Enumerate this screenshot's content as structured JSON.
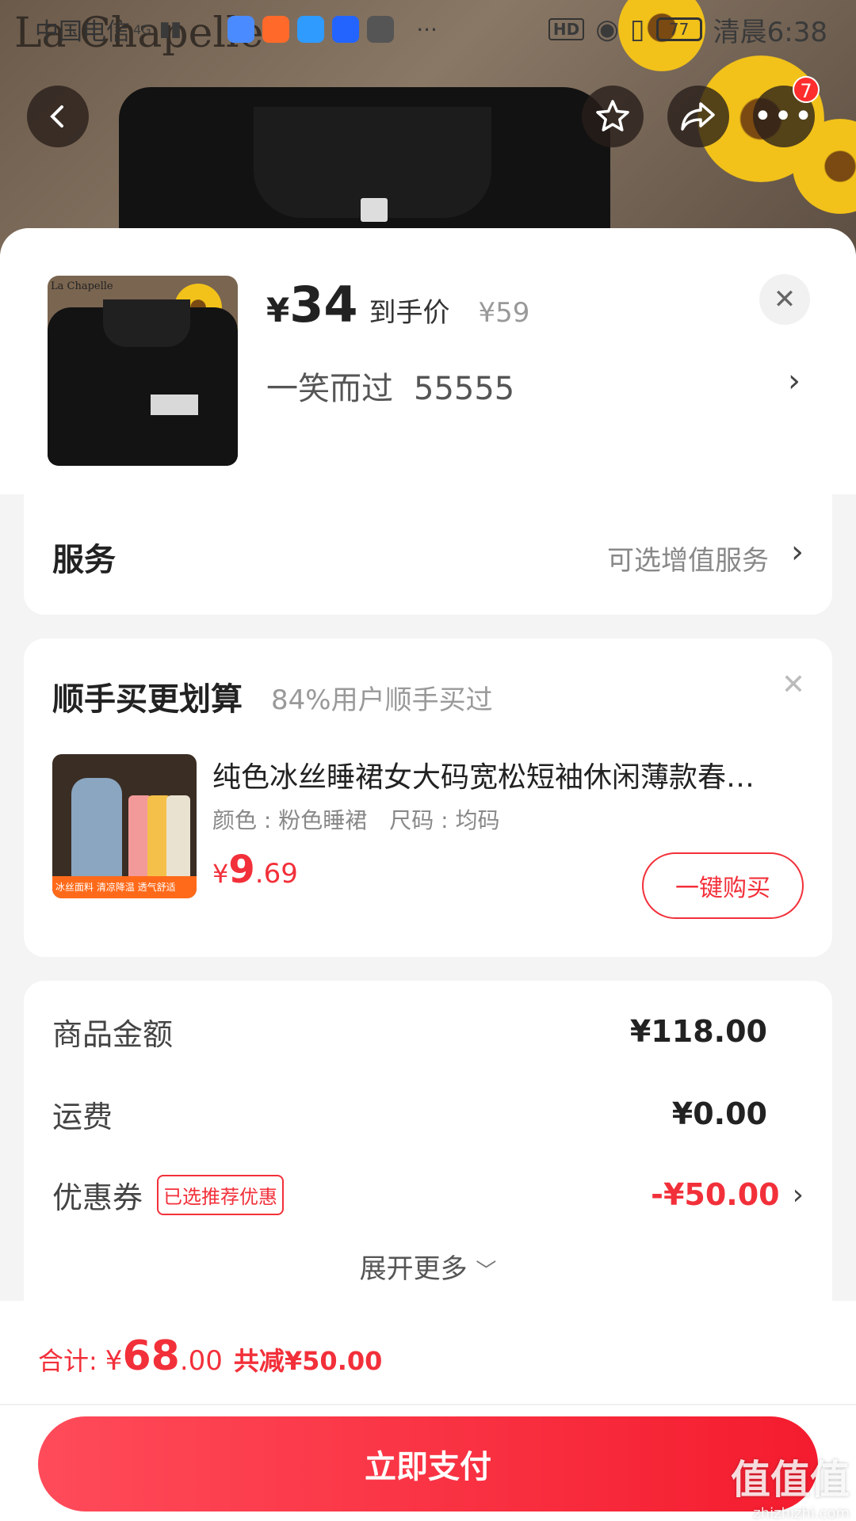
{
  "status_bar": {
    "carrier": "中国电信",
    "network": "4G",
    "time": "清晨6:38",
    "battery": "77",
    "hd": "HD"
  },
  "header": {
    "brand_watermark": "La Chapelle",
    "more_badge": "7"
  },
  "product": {
    "yen": "¥",
    "price": "34",
    "price_label": "到手价",
    "original_price": "¥59",
    "variant_color": "一笑而过",
    "variant_size": "55555",
    "thumb_brand": "La Chapelle"
  },
  "service": {
    "title": "服务",
    "right_text": "可选增值服务"
  },
  "upsell": {
    "title": "顺手买更划算",
    "subtitle": "84%用户顺手买过",
    "item_name": "纯色冰丝睡裙女大码宽松短袖休闲薄款春…",
    "spec_color": "颜色 : 粉色睡裙",
    "spec_size": "尺码 : 均码",
    "price_yen": "¥",
    "price_int": "9",
    "price_dec": ".69",
    "buy_label": "一键购买",
    "img_band": "冰丝面料 清凉降温 透气舒适"
  },
  "summary": {
    "goods_label": "商品金额",
    "goods_value": "¥118.00",
    "shipping_label": "运费",
    "shipping_value": "¥0.00",
    "coupon_label": "优惠券",
    "coupon_tag": "已选推荐优惠",
    "coupon_value": "-¥50.00",
    "expand_label": "展开更多"
  },
  "footer": {
    "total_label": "合计:",
    "total_yen": "¥",
    "total_int": "68",
    "total_dec": ".00",
    "saved": "共减¥50.00",
    "pay_label": "立即支付"
  },
  "watermark": {
    "text": "值值值",
    "url": "zhizhizhi.com"
  },
  "colors": {
    "accent_red": "#f2303a",
    "pay_gradient_start": "#ff4b5a",
    "pay_gradient_end": "#f41c2e"
  }
}
